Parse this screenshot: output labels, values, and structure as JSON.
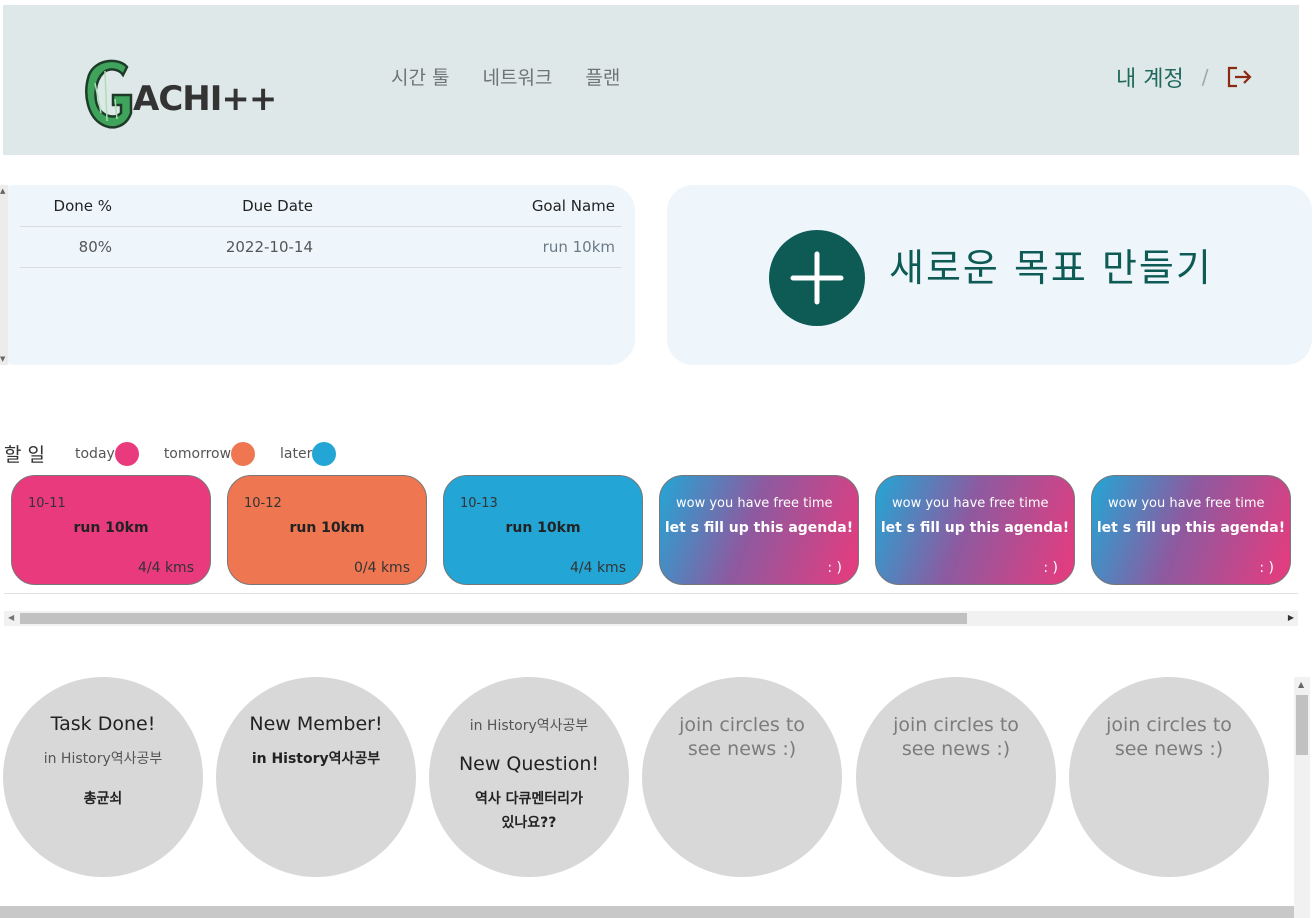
{
  "header": {
    "logo_text": "ACHI++",
    "nav": [
      "시간 툴",
      "네트워크",
      "플랜"
    ],
    "account_label": "내 계정",
    "separator": "/"
  },
  "goals": {
    "columns": [
      "Done %",
      "Due Date",
      "Goal Name"
    ],
    "rows": [
      {
        "done": "80%",
        "due": "2022-10-14",
        "name": "run 10km"
      }
    ]
  },
  "new_goal": {
    "label": "새로운 목표 만들기"
  },
  "todo": {
    "title": "할 일",
    "legend": [
      {
        "label": "today",
        "color": "#e93a7d"
      },
      {
        "label": "tomorrow",
        "color": "#ee7751"
      },
      {
        "label": "later",
        "color": "#23a6d5"
      }
    ],
    "cards": [
      {
        "date": "10-11",
        "name": "run 10km",
        "progress": "4/4 kms",
        "kind": "today"
      },
      {
        "date": "10-12",
        "name": "run 10km",
        "progress": "0/4 kms",
        "kind": "tomorrow"
      },
      {
        "date": "10-13",
        "name": "run 10km",
        "progress": "4/4 kms",
        "kind": "later"
      },
      {
        "date": "wow you have free time",
        "name": "let s fill up this agenda!",
        "progress": ": )",
        "kind": "free"
      },
      {
        "date": "wow you have free time",
        "name": "let s fill up this agenda!",
        "progress": ": )",
        "kind": "free"
      },
      {
        "date": "wow you have free time",
        "name": "let s fill up this agenda!",
        "progress": ": )",
        "kind": "free"
      }
    ]
  },
  "news": [
    {
      "title": "Task Done!",
      "sub": "in History역사공부",
      "detail": "총균쇠"
    },
    {
      "title": "New Member!",
      "sub": "in History역사공부"
    },
    {
      "pre": "in History역사공부",
      "title": "New Question!",
      "detail1": "역사 다큐멘터리가",
      "detail2": "있나요??"
    },
    {
      "join1": "join circles to",
      "join2": "see news :)"
    },
    {
      "join1": "join circles to",
      "join2": "see news :)"
    },
    {
      "join1": "join circles to",
      "join2": "see news :)"
    }
  ]
}
